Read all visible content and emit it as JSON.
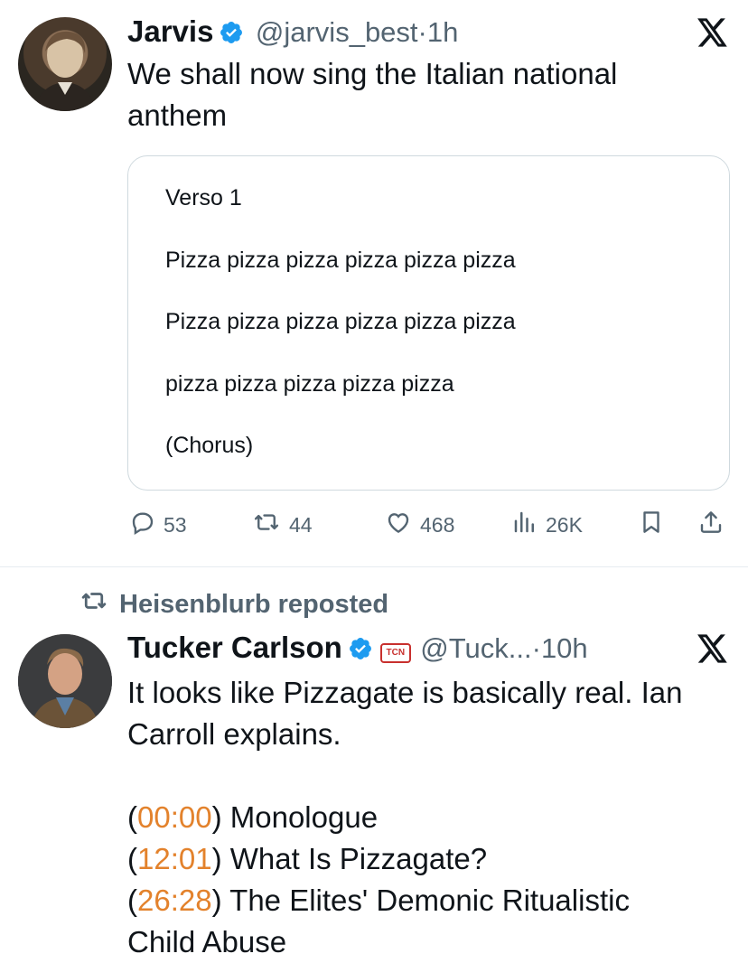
{
  "tweet1": {
    "name": "Jarvis",
    "handle": "@jarvis_best",
    "time": "1h",
    "separator": "·",
    "text_line1": "We shall now sing the Italian national",
    "text_line2": "anthem",
    "card": {
      "lines": [
        "Verso 1",
        "Pizza pizza pizza pizza pizza pizza",
        "Pizza pizza pizza pizza pizza pizza",
        "pizza pizza pizza pizza pizza",
        "(Chorus)"
      ]
    },
    "actions": {
      "replies": "53",
      "reposts": "44",
      "likes": "468",
      "views": "26K"
    }
  },
  "repost_banner": "Heisenblurb reposted",
  "tweet2": {
    "name": "Tucker Carlson",
    "badge": "TCN",
    "handle": "@Tuck...",
    "time": "10h",
    "separator": "·",
    "text_line1": "It looks like Pizzagate is basically real. Ian",
    "text_line2": "Carroll explains.",
    "chapters": [
      {
        "open": "(",
        "time": "00:00",
        "close": ")",
        "title": " Monologue"
      },
      {
        "open": "(",
        "time": "12:01",
        "close": ")",
        "title": " What Is Pizzagate?"
      },
      {
        "open": "(",
        "time": "26:28",
        "close": ")",
        "title": " The Elites' Demonic Ritualistic"
      }
    ],
    "chapter_continuation": "Child Abuse"
  },
  "colors": {
    "text": "#0f1419",
    "secondary": "#536471",
    "verified": "#1d9bf0",
    "timestamp": "#e3822c",
    "border": "#cfd9de"
  },
  "icons": [
    "x-logo-icon",
    "verified-badge-icon",
    "reply-icon",
    "repost-icon",
    "like-icon",
    "views-icon",
    "bookmark-icon",
    "share-icon"
  ]
}
